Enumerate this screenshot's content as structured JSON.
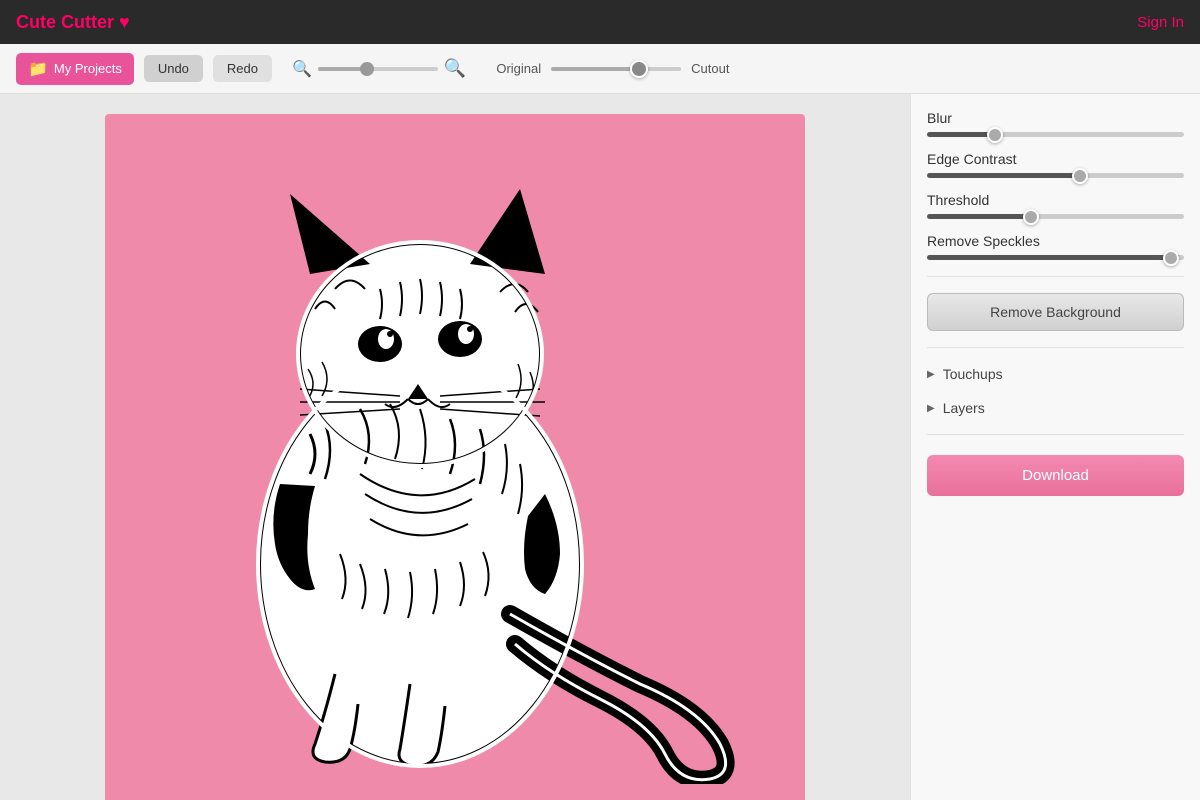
{
  "app": {
    "title": "Cute Cutter",
    "heart": "♥",
    "signin_label": "Sign In"
  },
  "toolbar": {
    "my_projects_label": "My Projects",
    "undo_label": "Undo",
    "redo_label": "Redo",
    "original_label": "Original",
    "cutout_label": "Cutout",
    "zoom_min_icon": "🔍",
    "zoom_max_icon": "🔍"
  },
  "panel": {
    "blur_label": "Blur",
    "blur_value": 25,
    "edge_contrast_label": "Edge Contrast",
    "edge_contrast_value": 60,
    "threshold_label": "Threshold",
    "threshold_value": 40,
    "remove_speckles_label": "Remove Speckles",
    "remove_speckles_value": 98,
    "remove_background_label": "Remove Background",
    "touchups_label": "Touchups",
    "layers_label": "Layers",
    "download_label": "Download"
  }
}
